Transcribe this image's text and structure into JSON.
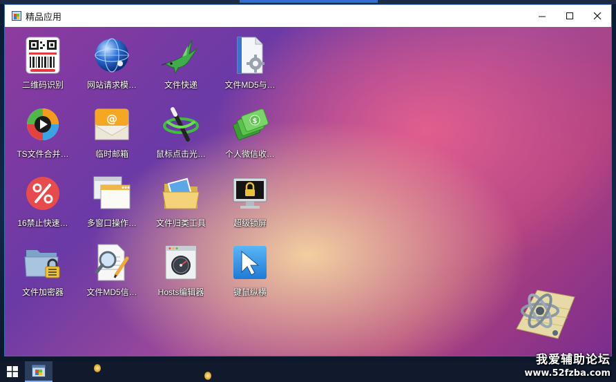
{
  "window": {
    "title": "精品应用",
    "controls": {
      "minimize": "—",
      "maximize": "☐",
      "close": "✕"
    }
  },
  "apps": [
    {
      "label": "二维码识别",
      "icon": "qrcode-icon"
    },
    {
      "label": "网站请求模…",
      "icon": "globe-icon"
    },
    {
      "label": "文件快递",
      "icon": "hummingbird-icon"
    },
    {
      "label": "文件MD5与…",
      "icon": "file-gear-icon"
    },
    {
      "label": "TS文件合并…",
      "icon": "media-player-icon"
    },
    {
      "label": "临时邮箱",
      "icon": "email-envelope-icon"
    },
    {
      "label": "鼠标点击光…",
      "icon": "magic-wand-icon"
    },
    {
      "label": "个人微信收…",
      "icon": "money-icon"
    },
    {
      "label": "16禁止快速…",
      "icon": "percent-icon"
    },
    {
      "label": "多窗口操作…",
      "icon": "multi-window-icon"
    },
    {
      "label": "文件归类工具",
      "icon": "folder-icon"
    },
    {
      "label": "超级锁屏",
      "icon": "lock-screen-icon"
    },
    {
      "label": "文件加密器",
      "icon": "locked-folder-icon"
    },
    {
      "label": "文件MD5信…",
      "icon": "file-search-icon"
    },
    {
      "label": "Hosts编辑器",
      "icon": "hosts-gauge-icon"
    },
    {
      "label": "键鼠纵横",
      "icon": "cursor-arrow-icon"
    }
  ],
  "watermark": {
    "line1": "我爱辅助论坛",
    "line2": "www.52fzba.com"
  }
}
